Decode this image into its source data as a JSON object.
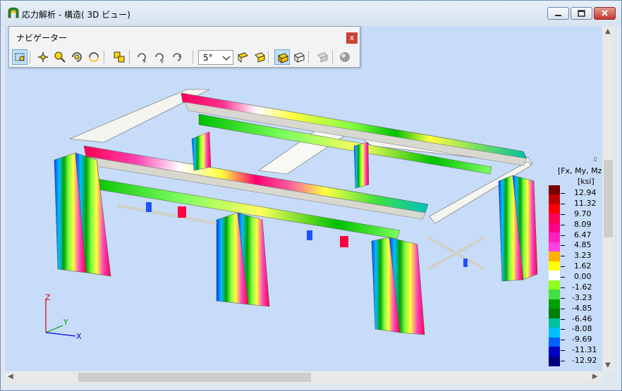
{
  "window": {
    "title": "応力解析 - 構造( 3D ビュー)",
    "buttons": {
      "minimize": "minimize",
      "maximize": "maximize",
      "close": "close"
    }
  },
  "navigator": {
    "title": "ナビゲーター",
    "close_label": "x",
    "angle_value": "5°",
    "tools": [
      {
        "name": "zoom-window-icon",
        "active": true
      },
      {
        "name": "pan-icon"
      },
      {
        "name": "zoom-icon"
      },
      {
        "name": "rotate-icon"
      },
      {
        "name": "rotate-free-icon"
      },
      {
        "name": "zoom-extents-icon"
      },
      {
        "name": "rotate-x-icon"
      },
      {
        "name": "rotate-y-icon"
      },
      {
        "name": "rotate-z-icon"
      },
      {
        "name": "view-front-icon"
      },
      {
        "name": "view-side-icon"
      },
      {
        "name": "solid-view-icon",
        "active": true
      },
      {
        "name": "wire-view-icon"
      },
      {
        "name": "hidden-view-icon"
      },
      {
        "name": "render-sphere-icon"
      }
    ]
  },
  "axes": {
    "x": "X",
    "y": "Y",
    "z": "Z"
  },
  "legend": {
    "unit_mark": "▯",
    "components": "[Fx, My, Mz]",
    "unit": "[ksi]",
    "values": [
      "12.94",
      "11.32",
      "9.70",
      "8.09",
      "6.47",
      "4.85",
      "3.23",
      "1.62",
      "0.00",
      "-1.62",
      "-3.23",
      "-4.85",
      "-6.46",
      "-8.08",
      "-9.69",
      "-11.31",
      "-12.92"
    ],
    "colors": [
      "#7a0000",
      "#c00000",
      "#ff0000",
      "#ff0050",
      "#ff0088",
      "#ff20c0",
      "#ff40e0",
      "#ffb000",
      "#ffff00",
      "#ffffff",
      "#8fff20",
      "#40e040",
      "#00a000",
      "#008000",
      "#00c0a0",
      "#00c0ff",
      "#0060ff",
      "#0000c0",
      "#000080"
    ]
  }
}
